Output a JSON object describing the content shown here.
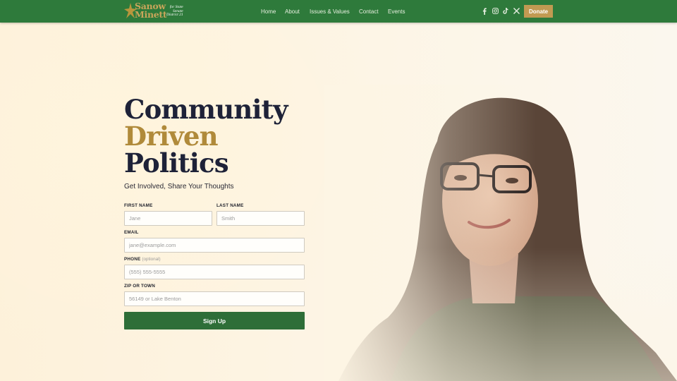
{
  "header": {
    "logo": {
      "name_line1": "Sanow",
      "name_line2": "Minett",
      "sub_line1": "for State",
      "sub_line2": "Senate",
      "sub_line3": "District 21"
    },
    "nav": [
      {
        "label": "Home"
      },
      {
        "label": "About"
      },
      {
        "label": "Issues & Values"
      },
      {
        "label": "Contact"
      },
      {
        "label": "Events"
      }
    ],
    "social_icons": [
      "facebook-icon",
      "instagram-icon",
      "tiktok-icon",
      "x-icon"
    ],
    "donate_label": "Donate"
  },
  "hero": {
    "headline_line1": "Community",
    "headline_line2": "Driven",
    "headline_line3": "Politics",
    "tagline": "Get Involved, Share Your Thoughts"
  },
  "form": {
    "first_name": {
      "label": "FIRST NAME",
      "placeholder": "Jane",
      "value": ""
    },
    "last_name": {
      "label": "LAST NAME",
      "placeholder": "Smith",
      "value": ""
    },
    "email": {
      "label": "EMAIL",
      "placeholder": "jane@example.com",
      "value": ""
    },
    "phone": {
      "label": "PHONE",
      "optional": "(optional)",
      "placeholder": "(555) 555-5555",
      "value": ""
    },
    "zip": {
      "label": "ZIP OR TOWN",
      "placeholder": "56149 or Lake Benton",
      "value": ""
    },
    "submit_label": "Sign Up"
  },
  "colors": {
    "header_green": "#2e7a3b",
    "gold": "#b08a3a",
    "navy": "#1e2238",
    "button_green": "#2e6e38",
    "background": "#fdf5e4"
  }
}
